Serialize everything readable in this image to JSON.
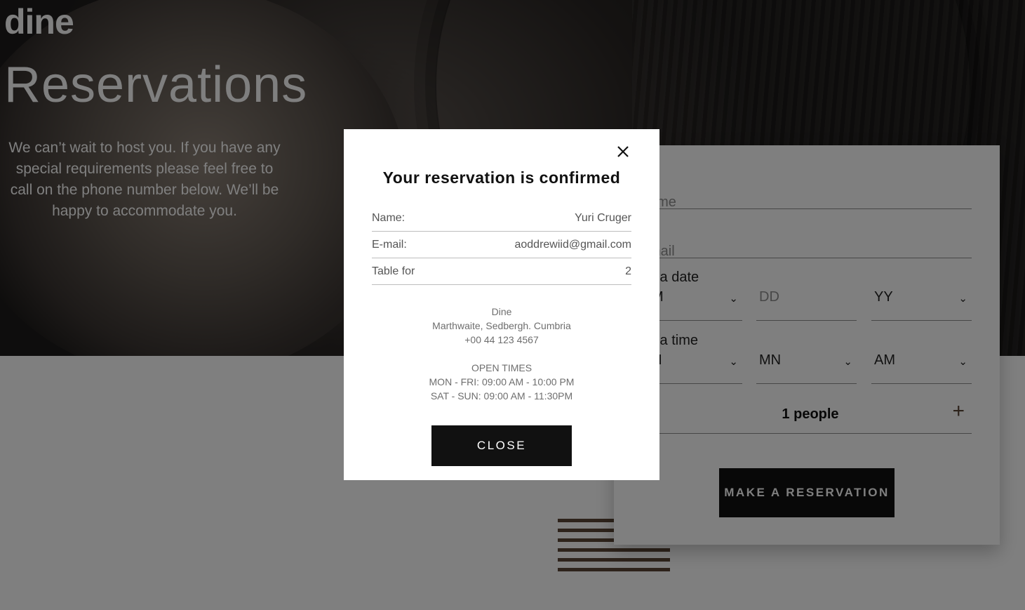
{
  "header": {
    "brand": "dine"
  },
  "hero": {
    "title": "Reservations",
    "text": "We can’t wait to host you. If you have any special requirements please feel free to call on the phone number below. We’ll be happy to accommodate you."
  },
  "booking_form": {
    "name_placeholder": "ame",
    "email_placeholder": "mail",
    "date_label": "k a date",
    "time_label": "k a time",
    "month_value": "M",
    "day_placeholder": "DD",
    "year_value": "YY",
    "hour_value": "H",
    "minute_value": "MN",
    "ampm_value": "AM",
    "people_count": "1 people",
    "plus_symbol": "+",
    "submit_label": "MAKE A RESERVATION"
  },
  "modal": {
    "title": "Your reservation is confirmed",
    "rows": [
      {
        "label": "Name:",
        "value": "Yuri Cruger"
      },
      {
        "label": "E-mail:",
        "value": "aoddrewiid@gmail.com"
      },
      {
        "label": "Table for",
        "value": "2"
      }
    ],
    "restaurant": {
      "name": "Dine",
      "address": "Marthwaite, Sedbergh. Cumbria",
      "phone": "+00 44 123 4567"
    },
    "open_times": {
      "heading": "OPEN TIMES",
      "weekdays": "MON - FRI: 09:00 AM - 10:00 PM",
      "weekend": "SAT - SUN: 09:00 AM - 11:30PM"
    },
    "close_label": "CLOSE"
  },
  "colors": {
    "accent": "#5b4636",
    "button": "#111111",
    "overlay": "rgba(0,0,0,0.5)"
  },
  "icons": {
    "close": "close-icon",
    "chevron": "chevron-down-icon",
    "plus": "plus-icon"
  }
}
